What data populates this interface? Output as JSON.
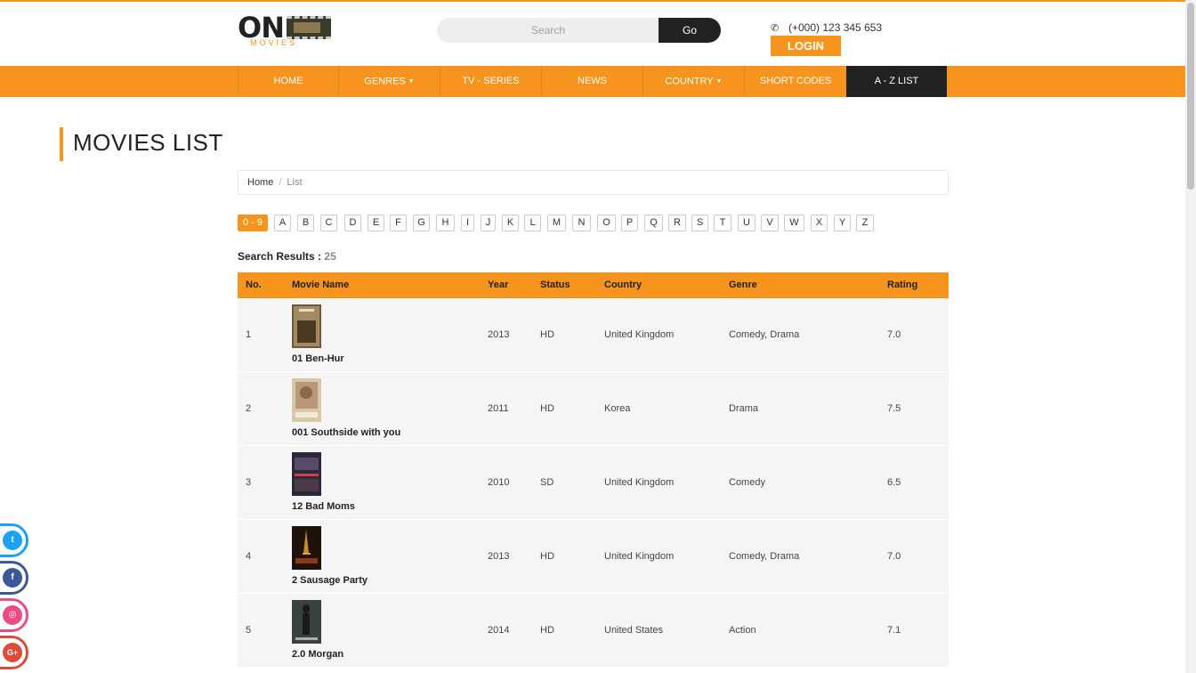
{
  "header": {
    "logo_text": "ON",
    "logo_sub": "MOVIES",
    "search_placeholder": "Search",
    "go_label": "Go",
    "phone": "(+000) 123 345 653",
    "login_label": "LOGIN"
  },
  "nav": {
    "items": [
      {
        "label": "HOME"
      },
      {
        "label": "GENRES"
      },
      {
        "label": "TV - SERIES"
      },
      {
        "label": "NEWS"
      },
      {
        "label": "COUNTRY"
      },
      {
        "label": "SHORT CODES"
      },
      {
        "label": "A - Z LIST"
      }
    ]
  },
  "page": {
    "title": "MOVIES LIST",
    "breadcrumb_home": "Home",
    "breadcrumb_sep": "/",
    "breadcrumb_current": "List",
    "results_label": "Search Results :",
    "results_count": "25"
  },
  "letters": [
    "0 - 9",
    "A",
    "B",
    "C",
    "D",
    "E",
    "F",
    "G",
    "H",
    "I",
    "J",
    "K",
    "L",
    "M",
    "N",
    "O",
    "P",
    "Q",
    "R",
    "S",
    "T",
    "U",
    "V",
    "W",
    "X",
    "Y",
    "Z"
  ],
  "table": {
    "headers": {
      "no": "No.",
      "name": "Movie Name",
      "year": "Year",
      "status": "Status",
      "country": "Country",
      "genre": "Genre",
      "rating": "Rating"
    },
    "rows": [
      {
        "no": "1",
        "name": "01 Ben-Hur",
        "year": "2013",
        "status": "HD",
        "country": "United Kingdom",
        "genre": "Comedy, Drama",
        "rating": "7.0"
      },
      {
        "no": "2",
        "name": "001 Southside with you",
        "year": "2011",
        "status": "HD",
        "country": "Korea",
        "genre": "Drama",
        "rating": "7.5"
      },
      {
        "no": "3",
        "name": "12 Bad Moms",
        "year": "2010",
        "status": "SD",
        "country": "United Kingdom",
        "genre": "Comedy",
        "rating": "6.5"
      },
      {
        "no": "4",
        "name": "2 Sausage Party",
        "year": "2013",
        "status": "HD",
        "country": "United Kingdom",
        "genre": "Comedy, Drama",
        "rating": "7.0"
      },
      {
        "no": "5",
        "name": "2.0 Morgan",
        "year": "2014",
        "status": "HD",
        "country": "United States",
        "genre": "Action",
        "rating": "7.1"
      }
    ]
  },
  "social": [
    {
      "icon": "twitter-icon",
      "glyph": "t",
      "color": "#1da1f2"
    },
    {
      "icon": "facebook-icon",
      "glyph": "f",
      "color": "#3b5998"
    },
    {
      "icon": "dribbble-icon",
      "glyph": "◎",
      "color": "#ea4c89"
    },
    {
      "icon": "google-plus-icon",
      "glyph": "G+",
      "color": "#dd4b39"
    }
  ],
  "colors": {
    "accent": "#f7941d",
    "dark": "#222222"
  }
}
